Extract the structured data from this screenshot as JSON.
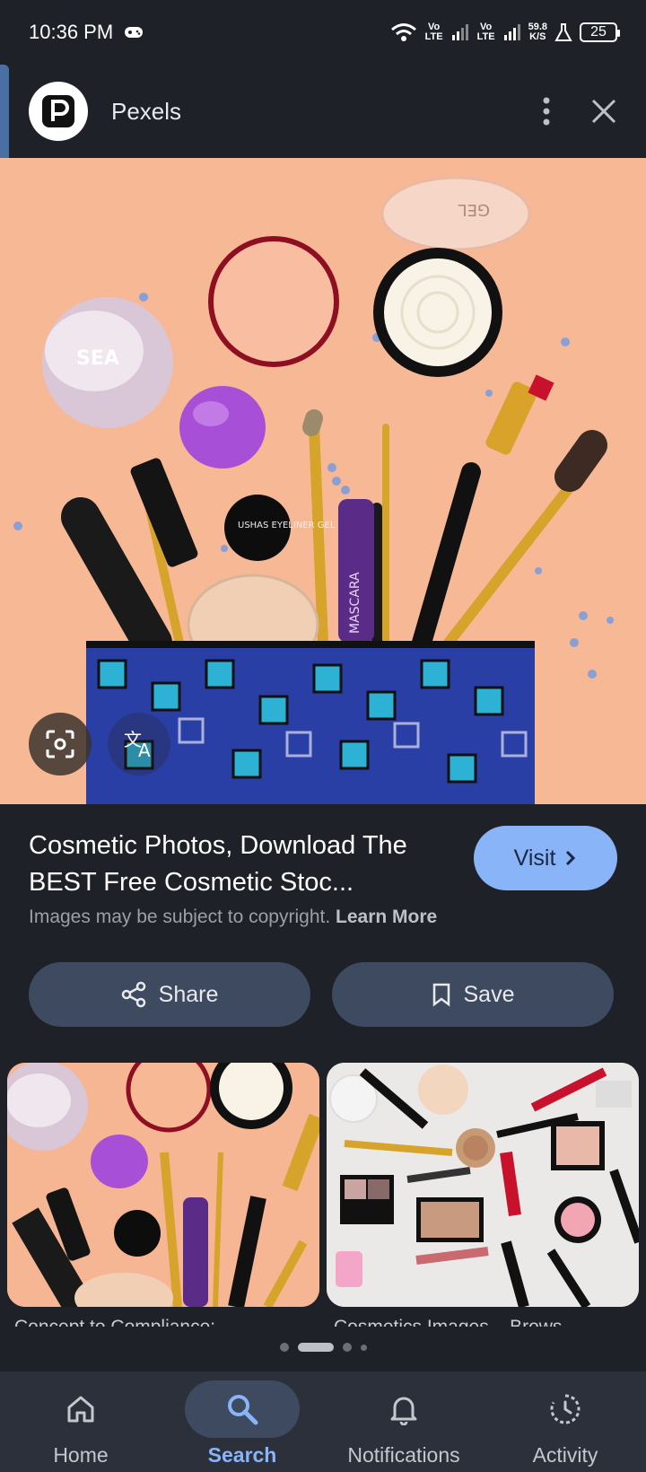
{
  "status_bar": {
    "time": "10:36 PM",
    "volte1": "Vo LTE",
    "volte2": "Vo LTE",
    "speed_value": "59.8",
    "speed_unit": "K/S",
    "battery": "25"
  },
  "header": {
    "site_name": "Pexels",
    "icons": [
      "pexels-logo-icon",
      "more-vert-icon",
      "close-icon"
    ]
  },
  "main_image": {
    "products": [
      "SEA",
      "USHAS EYELINER GEL",
      "MASCARA"
    ]
  },
  "result": {
    "title": "Cosmetic Photos, Download The BEST Free Cosmetic Stoc...",
    "visit_label": "Visit",
    "copyright_text": "Images may be subject to copyright.",
    "learn_more": "Learn More",
    "share_label": "Share",
    "save_label": "Save"
  },
  "related": [
    {
      "label": "Concept to Compliance:"
    },
    {
      "label": "Cosmetics Images – Brows"
    }
  ],
  "bottom_nav": {
    "items": [
      {
        "label": "Home",
        "icon": "home-icon"
      },
      {
        "label": "Search",
        "icon": "search-icon"
      },
      {
        "label": "Notifications",
        "icon": "bell-icon"
      },
      {
        "label": "Activity",
        "icon": "activity-icon"
      }
    ],
    "active": "Search"
  },
  "colors": {
    "background": "#1f2128",
    "accent": "#8ab4f8",
    "button_bg": "#3d4a5f",
    "nav_bg": "#2b303a",
    "image_bg": "#f7b896"
  }
}
